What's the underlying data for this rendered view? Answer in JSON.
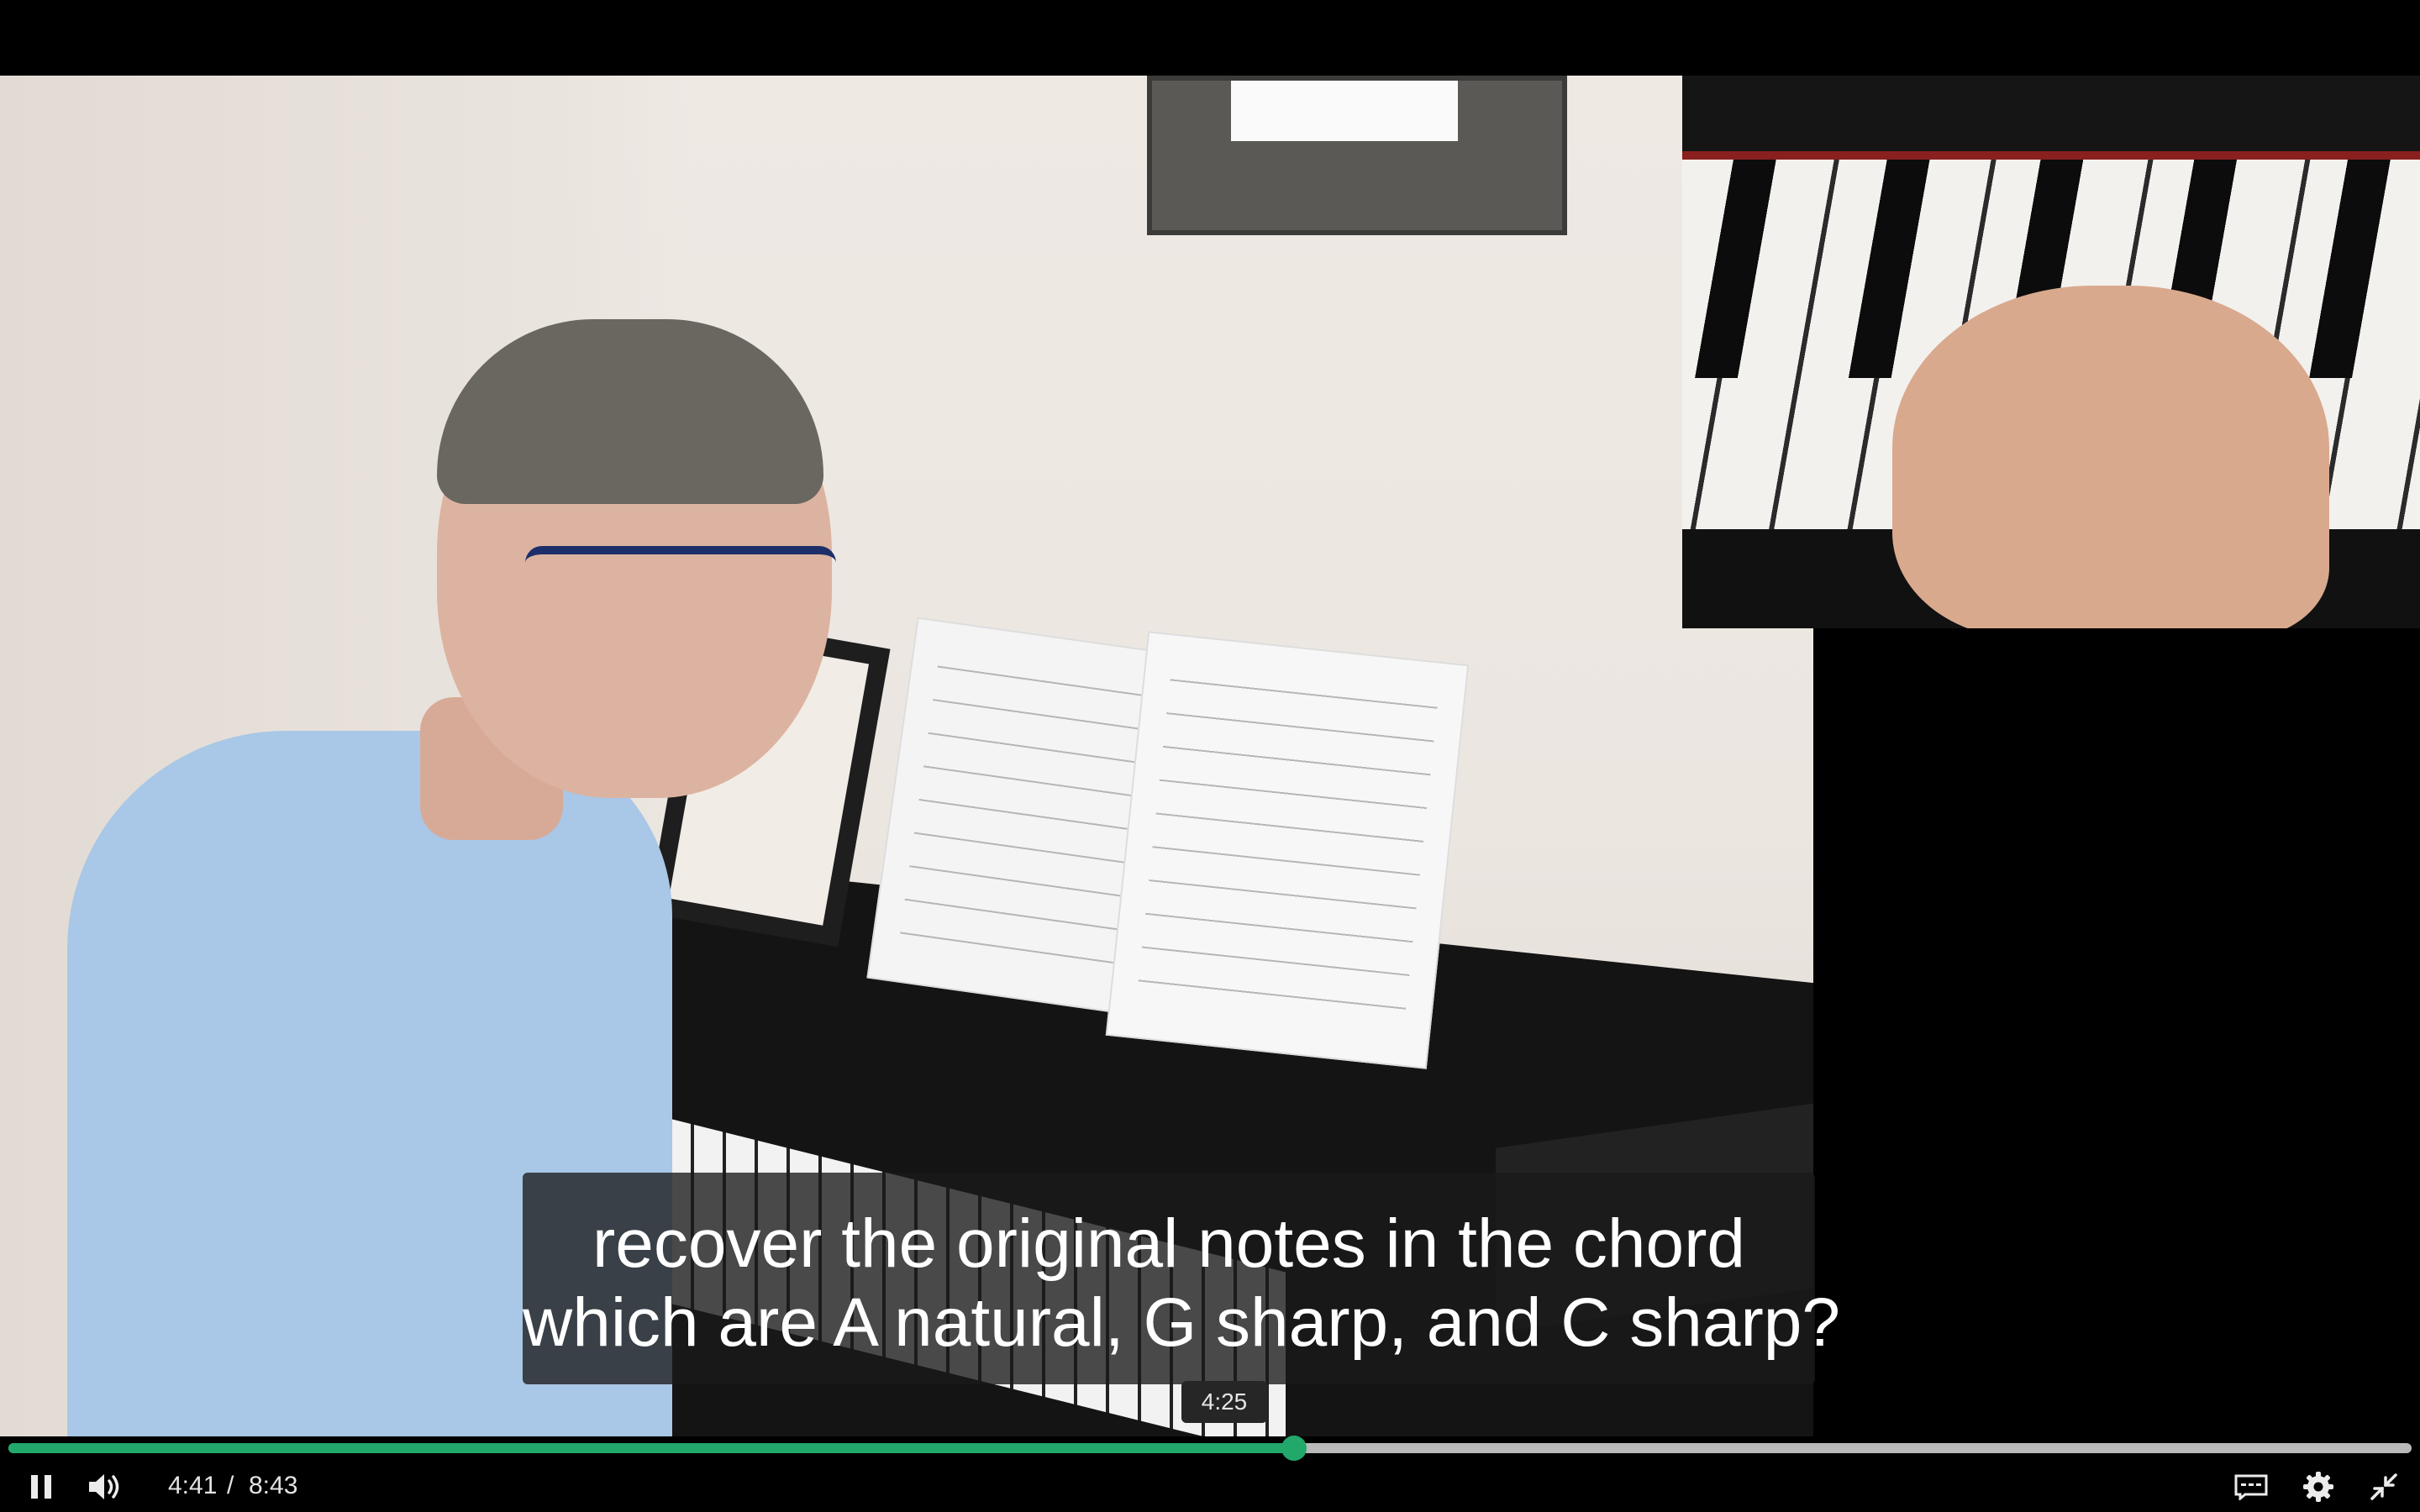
{
  "caption": {
    "line1": "recover the original notes in the chord",
    "line2": "which are A natural, G sharp, and C sharp?"
  },
  "seek_tooltip": "4:25",
  "playback": {
    "current_time": "4:41",
    "separator": "/",
    "duration": "8:43",
    "progress_fraction": 0.535
  },
  "controls": {
    "play_state_icon": "pause-icon",
    "volume_icon": "volume-icon",
    "captions_icon": "captions-icon",
    "settings_icon": "gear-icon",
    "fullscreen_icon": "exit-fullscreen-icon"
  },
  "colors": {
    "progress_played": "#22a86a",
    "progress_track": "#b9b9b9",
    "caption_background": "#191919"
  }
}
